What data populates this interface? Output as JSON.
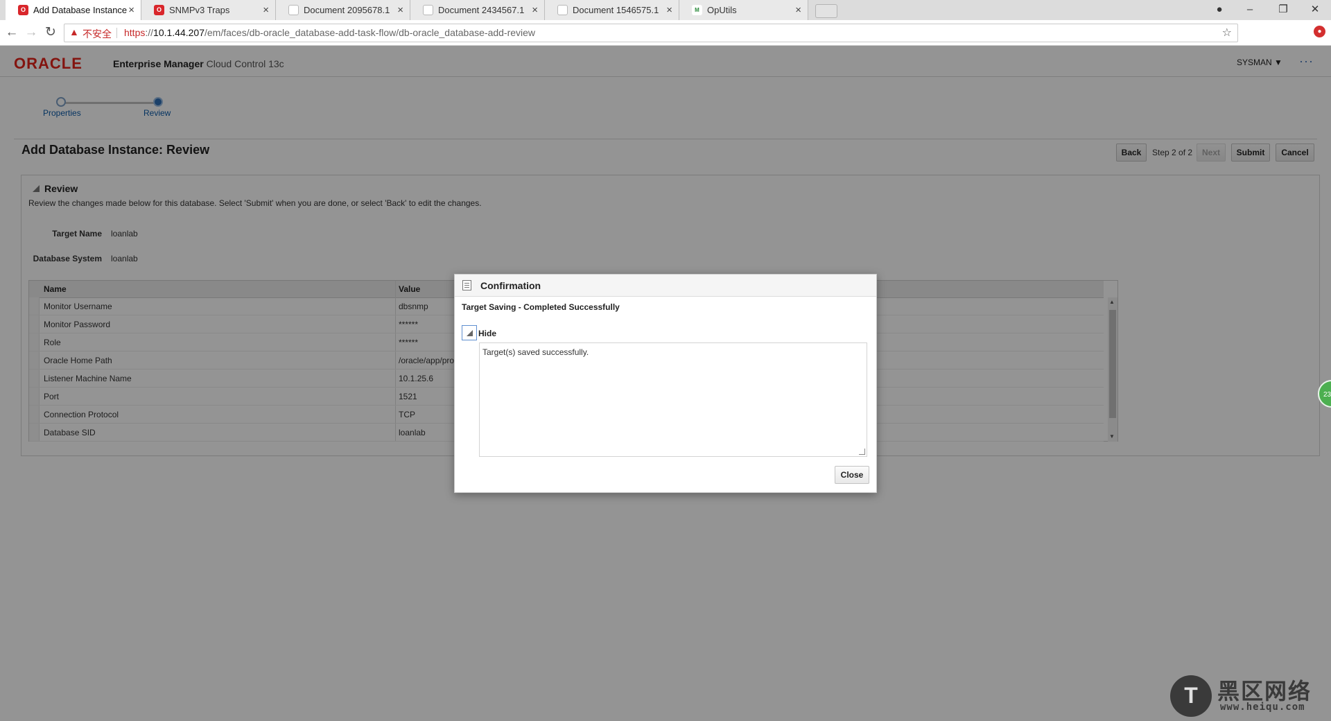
{
  "browser": {
    "tabs": [
      {
        "label": "Add Database Instance",
        "fav": "oracle-favicon-icon"
      },
      {
        "label": "SNMPv3 Traps",
        "fav": "oracle-favicon-icon"
      },
      {
        "label": "Document 2095678.1",
        "fav": "document-favicon-icon"
      },
      {
        "label": "Document 2434567.1",
        "fav": "document-favicon-icon"
      },
      {
        "label": "Document 1546575.1",
        "fav": "document-favicon-icon"
      },
      {
        "label": "OpUtils",
        "fav": "oputils-favicon-icon"
      }
    ],
    "tab_close": "×",
    "security_warning": "不安全",
    "url_scheme": "https",
    "url_sep": "://",
    "url_host": "10.1.44.207",
    "url_path": "/em/faces/db-oracle_database-add-task-flow/db-oracle_database-add-review",
    "fav_glyph": "M"
  },
  "header": {
    "logo": "ORACLE",
    "product": "Enterprise Manager",
    "subtitle": "Cloud Control 13c",
    "user": "SYSMAN ▼",
    "more": "···"
  },
  "train": {
    "steps": [
      {
        "label": "Properties"
      },
      {
        "label": "Review"
      }
    ]
  },
  "page": {
    "title": "Add Database Instance: Review",
    "buttons": {
      "back": "Back",
      "step_text": "Step 2 of 2",
      "next": "Next",
      "submit": "Submit",
      "cancel": "Cancel"
    }
  },
  "review": {
    "header": "Review",
    "description": "Review the changes made below for this database. Select 'Submit' when you are done, or select 'Back' to edit the changes.",
    "fields": [
      {
        "label": "Target Name",
        "value": "loanlab"
      },
      {
        "label": "Database System",
        "value": "loanlab"
      }
    ],
    "table": {
      "columns": [
        "Name",
        "Value"
      ],
      "rows": [
        {
          "name": "Monitor Username",
          "value": "dbsnmp"
        },
        {
          "name": "Monitor Password",
          "value": "******"
        },
        {
          "name": "Role",
          "value": "******"
        },
        {
          "name": "Oracle Home Path",
          "value": "/oracle/app/pro"
        },
        {
          "name": "Listener Machine Name",
          "value": "10.1.25.6"
        },
        {
          "name": "Port",
          "value": "1521"
        },
        {
          "name": "Connection Protocol",
          "value": "TCP"
        },
        {
          "name": "Database SID",
          "value": "loanlab"
        }
      ]
    }
  },
  "dialog": {
    "title": "Confirmation",
    "message": "Target Saving - Completed Successfully",
    "hide_label": "Hide",
    "detail": "Target(s) saved successfully.",
    "close": "Close"
  },
  "side_badge": "23",
  "watermark": {
    "glyph": "T",
    "cn": "黑区网络",
    "url": "www.heiqu.com"
  },
  "colors": {
    "oracle_red": "#e2231a",
    "link_blue": "#0b5aa8",
    "warning_red": "#c62828",
    "train_current": "#2f6fb5"
  }
}
